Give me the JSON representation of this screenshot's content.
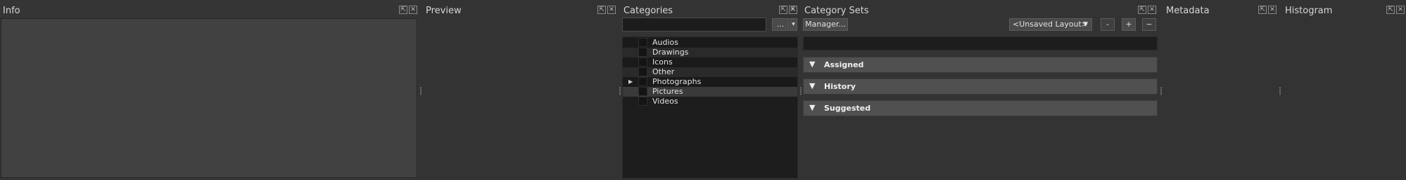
{
  "panels": {
    "info": {
      "title": "Info"
    },
    "preview": {
      "title": "Preview"
    },
    "categories": {
      "title": "Categories"
    },
    "category_sets": {
      "title": "Category Sets"
    },
    "metadata": {
      "title": "Metadata"
    },
    "histogram": {
      "title": "Histogram"
    }
  },
  "categories_toolbar": {
    "more_label": "...",
    "dropdown_glyph": "▾",
    "search_value": ""
  },
  "categories": [
    {
      "label": "Audios",
      "expandable": false
    },
    {
      "label": "Drawings",
      "expandable": false
    },
    {
      "label": "Icons",
      "expandable": false
    },
    {
      "label": "Other",
      "expandable": false
    },
    {
      "label": "Photographs",
      "expandable": true
    },
    {
      "label": "Pictures",
      "expandable": false
    },
    {
      "label": "Videos",
      "expandable": false
    }
  ],
  "category_sets_toolbar": {
    "manager_label": "Manager...",
    "layout_value": "<Unsaved Layout>",
    "minus_label": "-",
    "plus_label": "+",
    "tilde_label": "~"
  },
  "category_sets_sections": [
    {
      "label": "Assigned"
    },
    {
      "label": "History"
    },
    {
      "label": "Suggested"
    }
  ],
  "icons": {
    "float": "float-icon",
    "close": "close-icon",
    "expand": "triangle-right-icon",
    "collapse": "triangle-down-icon"
  },
  "colors": {
    "background": "#333333",
    "panel": "#353535",
    "list": "#1d1d1d",
    "section_header": "#505050",
    "text": "#d6d6d6"
  }
}
